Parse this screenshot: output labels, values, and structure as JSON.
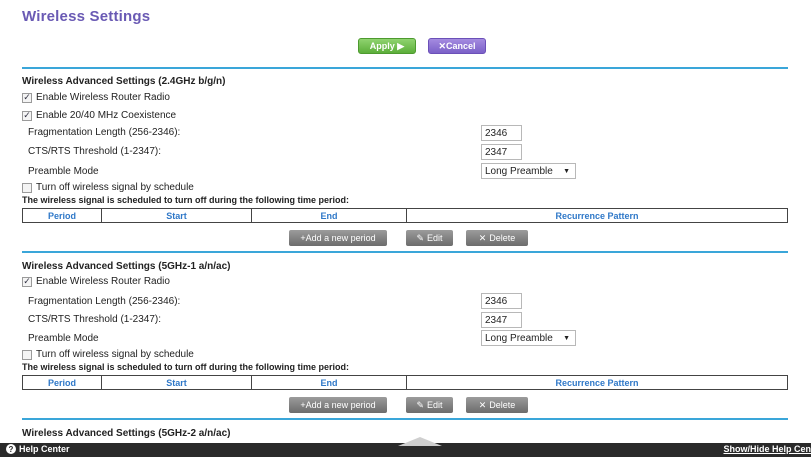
{
  "page": {
    "title": "Wireless Settings"
  },
  "toolbar": {
    "apply_label": "Apply ▶",
    "cancel_label": "✕Cancel"
  },
  "sections": [
    {
      "title": "Wireless Advanced Settings (2.4GHz b/g/n)",
      "enable_radio": "Enable Wireless Router Radio",
      "coexistence": "Enable 20/40 MHz Coexistence",
      "frag_label": "Fragmentation Length (256-2346):",
      "frag_value": "2346",
      "rts_label": "CTS/RTS Threshold (1-2347):",
      "rts_value": "2347",
      "preamble_label": "Preamble Mode",
      "preamble_value": "Long Preamble",
      "schedule_label": "Turn off wireless signal by schedule",
      "schedule_heading": "The wireless signal is scheduled to turn off during the following time period:"
    },
    {
      "title": "Wireless Advanced Settings (5GHz-1 a/n/ac)",
      "enable_radio": "Enable Wireless Router Radio",
      "frag_label": "Fragmentation Length (256-2346):",
      "frag_value": "2346",
      "rts_label": "CTS/RTS Threshold (1-2347):",
      "rts_value": "2347",
      "preamble_label": "Preamble Mode",
      "preamble_value": "Long Preamble",
      "schedule_label": "Turn off wireless signal by schedule",
      "schedule_heading": "The wireless signal is scheduled to turn off during the following time period:"
    },
    {
      "title": "Wireless Advanced Settings (5GHz-2 a/n/ac)"
    }
  ],
  "schedule_table": {
    "columns": [
      "Period",
      "Start",
      "End",
      "Recurrence Pattern"
    ]
  },
  "schedule_buttons": {
    "add": "+Add a new period",
    "edit": "Edit",
    "delete": "Delete"
  },
  "footer": {
    "help_center": "Help Center",
    "toggle": "Show/Hide Help Cen"
  },
  "icons": {
    "check": "check-icon",
    "edit": "pencil-icon",
    "delete": "x-icon",
    "help": "question-icon",
    "toggle": "triangle-up-icon"
  },
  "colors": {
    "title": "#6a5ab4",
    "apply": "#5cae3a",
    "cancel": "#7b60c8",
    "rule": "#3aa6d9",
    "table_header": "#2f78c8",
    "footer": "#2a2a2a"
  }
}
